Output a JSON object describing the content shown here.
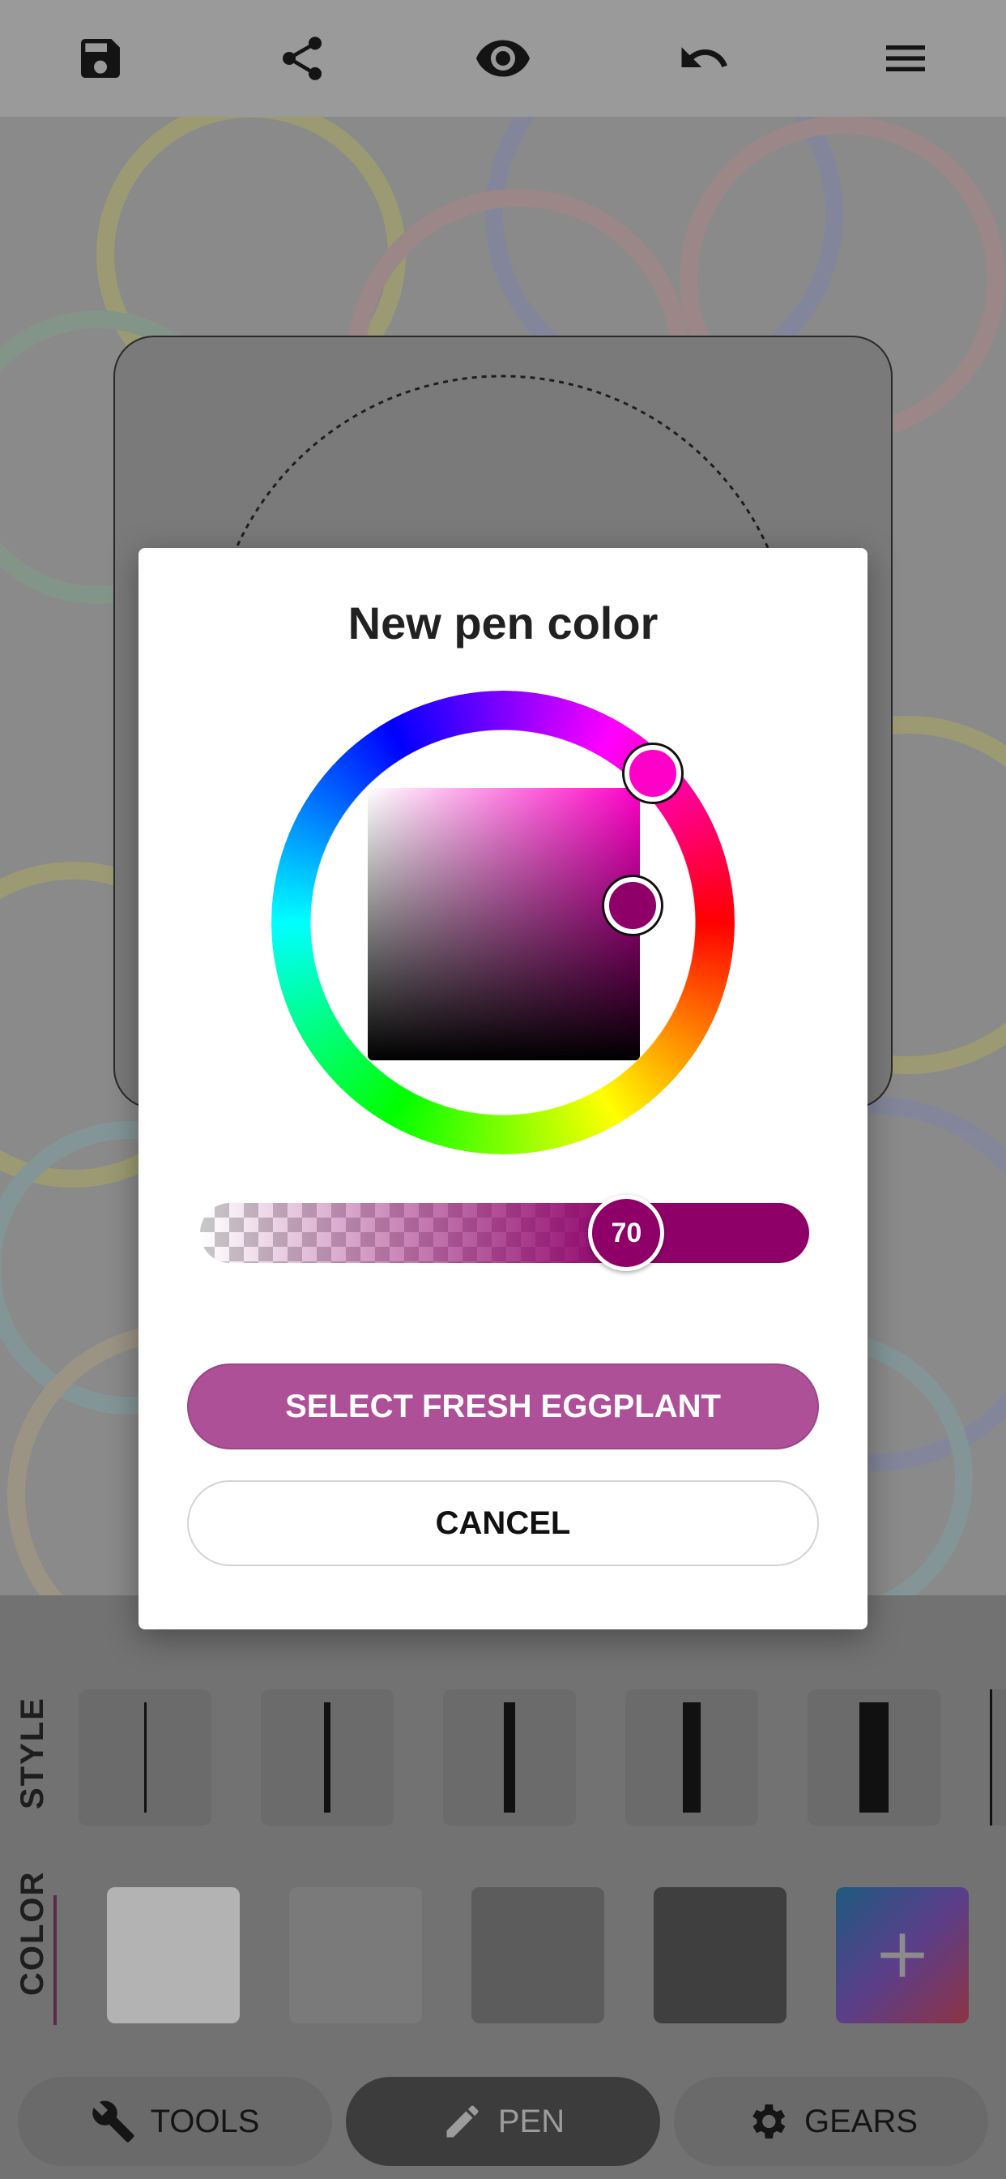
{
  "toolbar": {
    "icons": [
      "save-icon",
      "share-icon",
      "eye-icon",
      "undo-icon",
      "menu-icon"
    ]
  },
  "dialog": {
    "title": "New pen color",
    "alpha_value": "70",
    "alpha_level": 70,
    "selected_color": "#8e0068",
    "hue_color": "#ff00c8",
    "select_label": "SELECT FRESH EGGPLANT",
    "cancel_label": "CANCEL"
  },
  "style_row": {
    "label": "STYLE"
  },
  "color_row": {
    "label": "COLOR",
    "add_icon": "plus-icon"
  },
  "nav": {
    "tools": "TOOLS",
    "pen": "PEN",
    "gears": "GEARS"
  },
  "colors": {
    "accent": "#ae5098",
    "eggplant": "#8e0068"
  }
}
